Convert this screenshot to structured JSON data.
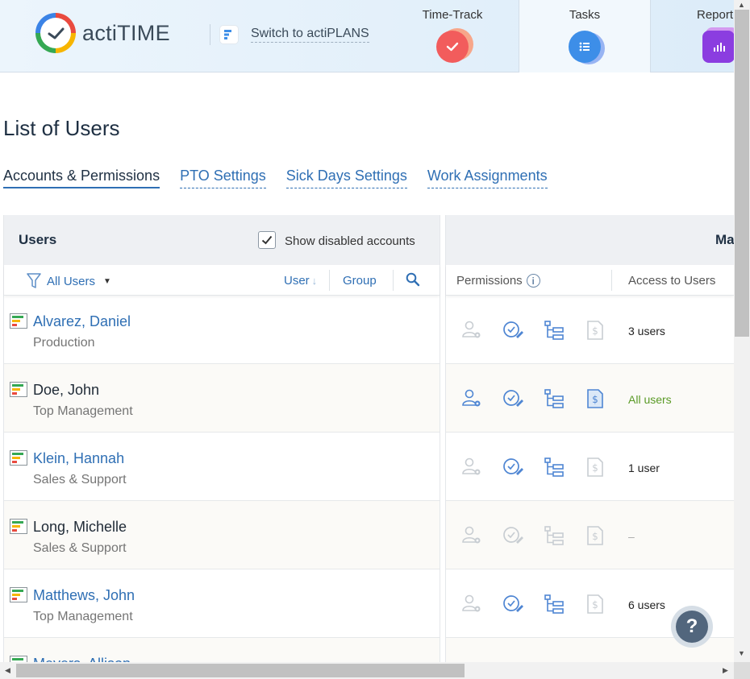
{
  "brand": {
    "name": "actiTIME",
    "switch_label": "Switch to actiPLANS"
  },
  "modules": [
    {
      "label": "Time-Track",
      "icon": "checkmark-icon",
      "color": "#f25c5c"
    },
    {
      "label": "Tasks",
      "icon": "list-icon",
      "color": "#3d8ee8"
    },
    {
      "label": "Report",
      "icon": "bar-chart-icon",
      "color": "#8b3de0"
    }
  ],
  "page": {
    "title": "List of Users"
  },
  "tabs": [
    {
      "label": "Accounts & Permissions",
      "active": true
    },
    {
      "label": "PTO Settings",
      "active": false
    },
    {
      "label": "Sick Days Settings",
      "active": false
    },
    {
      "label": "Work Assignments",
      "active": false
    }
  ],
  "users_panel": {
    "title": "Users",
    "show_disabled_label": "Show disabled accounts",
    "show_disabled_checked": true,
    "filter_label": "All Users",
    "sort_user_label": "User",
    "sort_group_label": "Group"
  },
  "right_panel": {
    "title": "Ma",
    "permissions_label": "Permissions",
    "access_label": "Access to Users"
  },
  "users": [
    {
      "name": "Alvarez, Daniel",
      "dept": "Production",
      "link": true,
      "access": "3 users",
      "perms": [
        false,
        true,
        true,
        false
      ]
    },
    {
      "name": "Doe, John",
      "dept": "Top Management",
      "link": false,
      "access": "All users",
      "perms": [
        true,
        true,
        true,
        true
      ]
    },
    {
      "name": "Klein, Hannah",
      "dept": "Sales & Support",
      "link": true,
      "access": "1 user",
      "perms": [
        false,
        true,
        true,
        false
      ]
    },
    {
      "name": "Long, Michelle",
      "dept": "Sales & Support",
      "link": false,
      "access": "–",
      "perms": [
        false,
        false,
        false,
        false
      ]
    },
    {
      "name": "Matthews, John",
      "dept": "Top Management",
      "link": true,
      "access": "6 users",
      "perms": [
        false,
        true,
        true,
        false
      ]
    },
    {
      "name": "Meyers, Allison",
      "dept": "",
      "link": true,
      "access": "",
      "perms": [
        false,
        false,
        false,
        false
      ]
    }
  ],
  "help": {
    "label": "?"
  },
  "colors": {
    "link": "#2f6fb4",
    "accent_green": "#5a9a26",
    "perm_on": "#4f86d3",
    "perm_off": "#c8cdd2"
  }
}
